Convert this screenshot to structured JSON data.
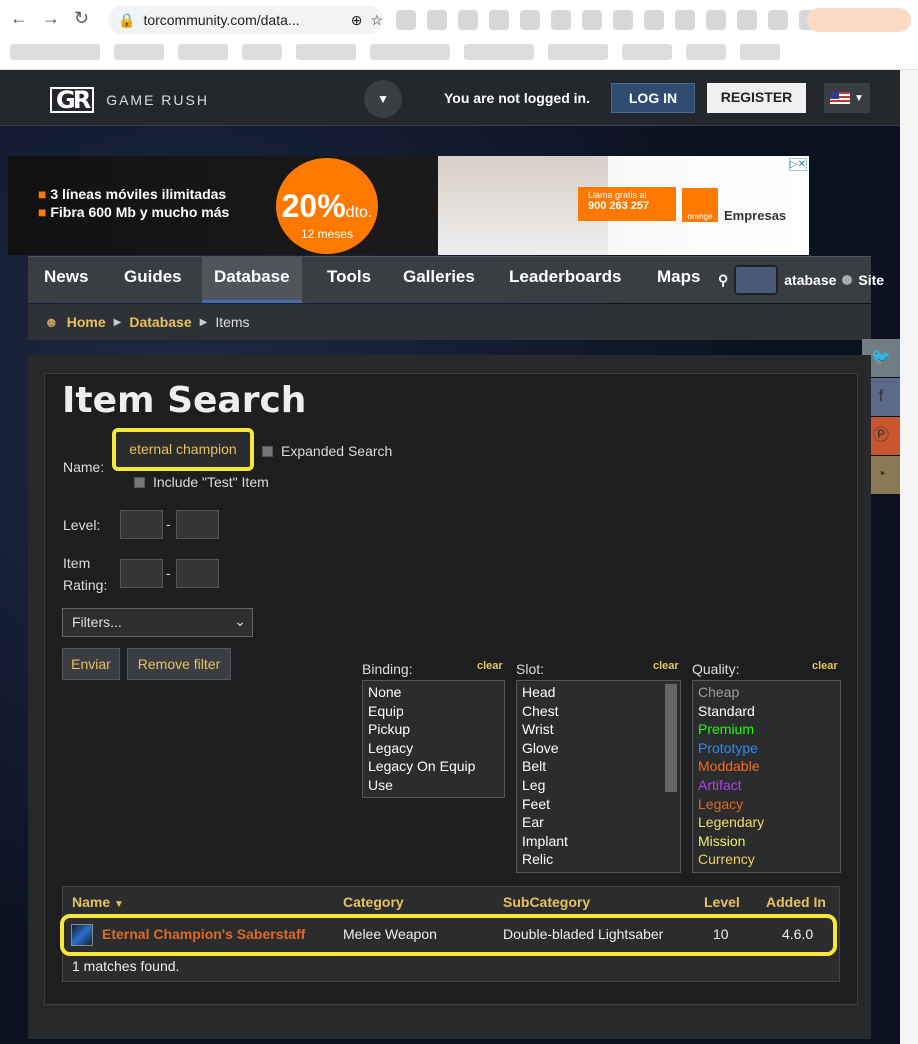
{
  "browser": {
    "url": "torcommunity.com/data..."
  },
  "header": {
    "brand": "GAME RUSH",
    "logo_mark": "GR",
    "status": "You are not logged in.",
    "login": "LOG IN",
    "register": "REGISTER"
  },
  "ad": {
    "line1": "3 líneas móviles ilimitadas",
    "line2": "Fibra 600 Mb y mucho más",
    "discount": "20%",
    "discount_suffix": "dto.",
    "discount_sub": "12 meses",
    "call_label": "Llama gratis al",
    "phone": "900 263 257",
    "orange": "orange",
    "empresas": "Empresas"
  },
  "nav": {
    "items": [
      "News",
      "Guides",
      "Database",
      "Tools",
      "Galleries",
      "Leaderboards",
      "Maps"
    ],
    "search_db": "atabase",
    "search_site": "Site"
  },
  "breadcrumb": {
    "home": "Home",
    "database": "Database",
    "items": "Items"
  },
  "search": {
    "title": "Item Search",
    "name_label": "Name:",
    "name_value": "eternal champion",
    "expanded": "Expanded Search",
    "include_test": "Include \"Test\" Item",
    "level_label": "Level:",
    "rating_label_1": "Item",
    "rating_label_2": "Rating:",
    "dash": "-",
    "filters": "Filters...",
    "submit": "Enviar",
    "remove": "Remove filter",
    "clear": "clear",
    "binding_label": "Binding:",
    "binding": [
      "None",
      "Equip",
      "Pickup",
      "Legacy",
      "Legacy On Equip",
      "Use"
    ],
    "slot_label": "Slot:",
    "slot": [
      "Head",
      "Chest",
      "Wrist",
      "Glove",
      "Belt",
      "Leg",
      "Feet",
      "Ear",
      "Implant",
      "Relic"
    ],
    "quality_label": "Quality:",
    "quality": [
      {
        "name": "Cheap",
        "color": "#9d9d9d"
      },
      {
        "name": "Standard",
        "color": "#ffffff"
      },
      {
        "name": "Premium",
        "color": "#1eff00"
      },
      {
        "name": "Prototype",
        "color": "#2a8cf0"
      },
      {
        "name": "Moddable",
        "color": "#ff6a1a"
      },
      {
        "name": "Artifact",
        "color": "#b040e8"
      },
      {
        "name": "Legacy",
        "color": "#e06a20"
      },
      {
        "name": "Legendary",
        "color": "#f0e060"
      },
      {
        "name": "Mission",
        "color": "#f0f060"
      },
      {
        "name": "Currency",
        "color": "#f0d060"
      }
    ]
  },
  "results": {
    "columns": [
      "Name",
      "Category",
      "SubCategory",
      "Level",
      "Added In"
    ],
    "rows": [
      {
        "name": "Eternal Champion's Saberstaff",
        "category": "Melee Weapon",
        "subcategory": "Double-bladed Lightsaber",
        "level": "10",
        "added": "4.6.0"
      }
    ],
    "count": "1 matches found."
  }
}
